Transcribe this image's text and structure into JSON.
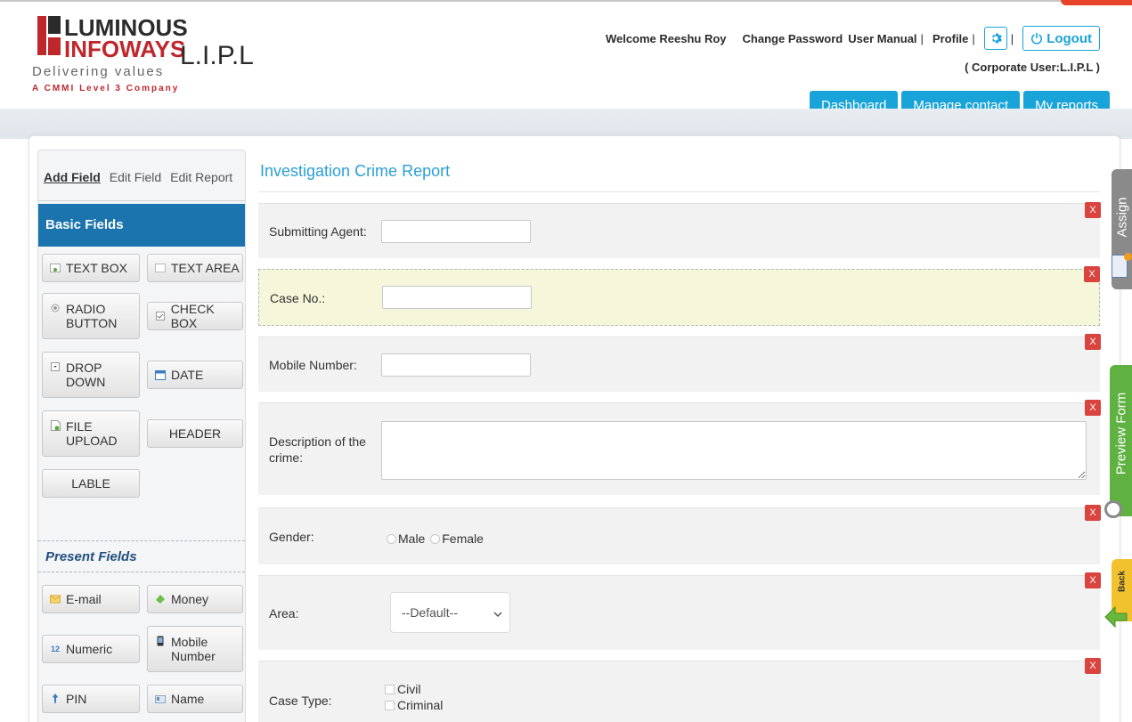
{
  "header": {
    "logo_line1": "LUMINOUS",
    "logo_line2": "INFOWAYS",
    "logo_suffix": "L.I.P.L",
    "tagline": "Delivering values",
    "cmmi": "A CMMI Level 3 Company",
    "welcome": "Welcome Reeshu Roy",
    "change_password": "Change Password",
    "user_manual": "User Manual",
    "profile": "Profile",
    "logout": "Logout",
    "corporate_user": "( Corporate User:L.I.P.L )"
  },
  "main_nav": [
    "Dashboard",
    "Manage contact",
    "My reports"
  ],
  "sidebar": {
    "tabs": [
      "Add Field",
      "Edit Field",
      "Edit Report"
    ],
    "basic_title": "Basic Fields",
    "basic_fields": [
      {
        "label": "TEXT BOX",
        "icon": "textbox-icon"
      },
      {
        "label": "TEXT AREA",
        "icon": "textarea-icon"
      },
      {
        "label": "RADIO BUTTON",
        "icon": "radio-icon"
      },
      {
        "label": "CHECK BOX",
        "icon": "checkbox-icon"
      },
      {
        "label": "DROP DOWN",
        "icon": "dropdown-icon"
      },
      {
        "label": "DATE",
        "icon": "calendar-icon"
      },
      {
        "label": "FILE UPLOAD",
        "icon": "file-upload-icon"
      },
      {
        "label": "HEADER",
        "icon": ""
      },
      {
        "label": "LABLE",
        "icon": ""
      }
    ],
    "present_title": "Present Fields",
    "present_fields": [
      {
        "label": "E-mail",
        "icon": "envelope-icon"
      },
      {
        "label": "Money",
        "icon": "money-icon"
      },
      {
        "label": "Numeric",
        "icon": "numeric-icon"
      },
      {
        "label": "Mobile Number",
        "icon": "mobile-icon"
      },
      {
        "label": "PIN",
        "icon": "pin-icon"
      },
      {
        "label": "Name",
        "icon": "name-card-icon"
      }
    ]
  },
  "form": {
    "title": "Investigation Crime Report",
    "fields": [
      {
        "label": "Submitting Agent:",
        "type": "text",
        "value": ""
      },
      {
        "label": "Case No.:",
        "type": "text",
        "value": ""
      },
      {
        "label": "Mobile Number:",
        "type": "text",
        "value": ""
      },
      {
        "label": "Description of the crime:",
        "type": "textarea",
        "value": ""
      },
      {
        "label": "Gender:",
        "type": "radio",
        "options": [
          "Male",
          "Female"
        ]
      },
      {
        "label": "Area:",
        "type": "select",
        "selected": "--Default--"
      },
      {
        "label": "Case Type:",
        "type": "checkbox",
        "options": [
          "Civil",
          "Criminal"
        ]
      }
    ],
    "remove_label": "X"
  },
  "side_tabs": [
    "Assign",
    "Preview Form",
    "Back"
  ],
  "colors": {
    "accent": "#18a3d9",
    "sidebar_header": "#1b74ad",
    "remove": "#d9443f",
    "highlight_row": "#f6f6db",
    "preview_tab": "#5fb141",
    "back_tab": "#f2c12e",
    "assign_tab": "#8a8a8a"
  }
}
